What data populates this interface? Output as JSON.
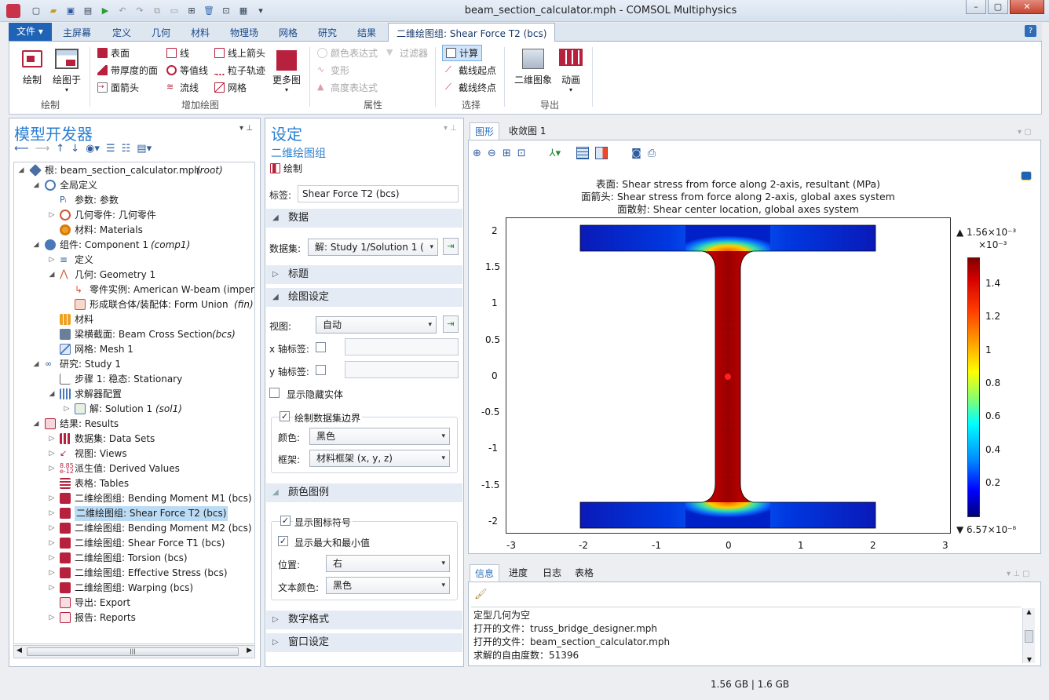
{
  "window": {
    "title": "beam_section_calculator.mph - COMSOL Multiphysics"
  },
  "menu": {
    "file": "文件",
    "tabs": [
      "主屏幕",
      "定义",
      "几何",
      "材料",
      "物理场",
      "网格",
      "研究",
      "结果"
    ],
    "active_tab": "二维绘图组: Shear Force T2 (bcs)",
    "help": "?"
  },
  "ribbon": {
    "plot": {
      "plot_label": "绘制",
      "plot_in_label": "绘图于",
      "group": "绘制"
    },
    "add_plot": {
      "surface": "表面",
      "line": "线",
      "line_arrow": "线上箭头",
      "height_surface": "带厚度的面",
      "contour": "等值线",
      "particle": "粒子轨迹",
      "surface_arrow": "面箭头",
      "streamline": "流线",
      "mesh": "网格",
      "more": "更多图",
      "group": "增加绘图"
    },
    "attributes": {
      "color_expr": "颜色表达式",
      "filter": "过滤器",
      "deform": "变形",
      "height_expr": "高度表达式",
      "group": "属性"
    },
    "select": {
      "compute": "计算",
      "cut_start": "截线起点",
      "cut_end": "截线终点",
      "group": "选择"
    },
    "export": {
      "image2d": "二维图象",
      "animation": "动画",
      "group": "导出"
    }
  },
  "model_builder": {
    "title": "模型开发器",
    "tree": [
      {
        "id": "root",
        "label": "根: beam_section_calculator.mph",
        "tag": "(root)"
      },
      {
        "id": "global",
        "label": "全局定义",
        "tag": ""
      },
      {
        "id": "params",
        "label": "参数: 参数",
        "tag": ""
      },
      {
        "id": "geomparts",
        "label": "几何零件: 几何零件",
        "tag": ""
      },
      {
        "id": "materials",
        "label": "材料: Materials",
        "tag": ""
      },
      {
        "id": "comp",
        "label": "组件: Component 1",
        "tag": "(comp1)"
      },
      {
        "id": "defs",
        "label": "定义",
        "tag": ""
      },
      {
        "id": "geom",
        "label": "几何: Geometry 1",
        "tag": ""
      },
      {
        "id": "part",
        "label": "零件实例: American W-beam (imperia",
        "tag": ""
      },
      {
        "id": "fin",
        "label": "形成联合体/装配体: Form Union",
        "tag": "(fin)"
      },
      {
        "id": "mat",
        "label": "材料",
        "tag": ""
      },
      {
        "id": "bcs",
        "label": "梁横截面: Beam Cross Section",
        "tag": "(bcs)"
      },
      {
        "id": "mesh",
        "label": "网格: Mesh 1",
        "tag": ""
      },
      {
        "id": "study",
        "label": "研究: Study 1",
        "tag": ""
      },
      {
        "id": "step",
        "label": "步骤 1: 稳态: Stationary",
        "tag": ""
      },
      {
        "id": "solver",
        "label": "求解器配置",
        "tag": ""
      },
      {
        "id": "sol",
        "label": "解: Solution 1",
        "tag": "(sol1)"
      },
      {
        "id": "results",
        "label": "结果: Results",
        "tag": ""
      },
      {
        "id": "datasets",
        "label": "数据集: Data Sets",
        "tag": ""
      },
      {
        "id": "views",
        "label": "视图: Views",
        "tag": ""
      },
      {
        "id": "derived",
        "label": "派生值: Derived Values",
        "tag": ""
      },
      {
        "id": "tables",
        "label": "表格: Tables",
        "tag": ""
      },
      {
        "id": "pg_m1",
        "label": "二维绘图组: Bending Moment M1 (bcs)",
        "tag": ""
      },
      {
        "id": "pg_t2",
        "label": "二维绘图组: Shear Force T2 (bcs)",
        "tag": ""
      },
      {
        "id": "pg_m2",
        "label": "二维绘图组: Bending Moment M2 (bcs)",
        "tag": ""
      },
      {
        "id": "pg_t1",
        "label": "二维绘图组: Shear Force T1 (bcs)",
        "tag": ""
      },
      {
        "id": "pg_tor",
        "label": "二维绘图组: Torsion (bcs)",
        "tag": ""
      },
      {
        "id": "pg_eff",
        "label": "二维绘图组: Effective Stress (bcs)",
        "tag": ""
      },
      {
        "id": "pg_warp",
        "label": "二维绘图组: Warping (bcs)",
        "tag": ""
      },
      {
        "id": "export",
        "label": "导出: Export",
        "tag": ""
      },
      {
        "id": "reports",
        "label": "报告: Reports",
        "tag": ""
      }
    ]
  },
  "settings": {
    "title": "设定",
    "subtitle": "二维绘图组",
    "plot_btn": "绘制",
    "label_label": "标签:",
    "label_value": "Shear Force T2 (bcs)",
    "sec_data": "数据",
    "dataset_label": "数据集:",
    "dataset_value": "解: Study 1/Solution 1 (",
    "sec_title": "标题",
    "sec_plot_settings": "绘图设定",
    "view_label": "视图:",
    "view_value": "自动",
    "xlabel_label": "x 轴标签:",
    "ylabel_label": "y 轴标签:",
    "show_hidden": "显示隐藏实体",
    "draw_boundary": "绘制数据集边界",
    "color_label": "颜色:",
    "color_value": "黑色",
    "frame_label": "框架:",
    "frame_value": "材料框架  (x, y, z)",
    "sec_legend": "颜色图例",
    "show_legend": "显示图标符号",
    "show_minmax": "显示最大和最小值",
    "pos_label": "位置:",
    "pos_value": "右",
    "textcolor_label": "文本颜色:",
    "textcolor_value": "黑色",
    "sec_number_format": "数字格式",
    "sec_window": "窗口设定"
  },
  "graphics": {
    "tabs": [
      "图形",
      "收敛图 1"
    ],
    "title_lines": [
      "表面: Shear stress from force along 2-axis, resultant (MPa)",
      "面箭头: Shear stress from force along 2-axis, global axes system",
      "面散射: Shear center location, global axes system"
    ],
    "xticks": [
      "-3",
      "-2",
      "-1",
      "0",
      "1",
      "2",
      "3"
    ],
    "yticks": [
      "2",
      "1.5",
      "1",
      "0.5",
      "0",
      "-0.5",
      "-1",
      "-1.5",
      "-2"
    ],
    "legend": {
      "max": "▲ 1.56×10⁻³",
      "unit": "×10⁻³",
      "min": "▼ 6.57×10⁻⁸",
      "ticks": [
        "1.4",
        "1.2",
        "1",
        "0.8",
        "0.6",
        "0.4",
        "0.2"
      ]
    }
  },
  "messages": {
    "tabs": [
      "信息",
      "进度",
      "日志",
      "表格"
    ],
    "lines": [
      "定型几何为空",
      "打开的文件：truss_bridge_designer.mph",
      "打开的文件：beam_section_calculator.mph",
      "求解的自由度数：51396"
    ]
  },
  "status": {
    "memory": "1.56 GB | 1.6 GB"
  }
}
